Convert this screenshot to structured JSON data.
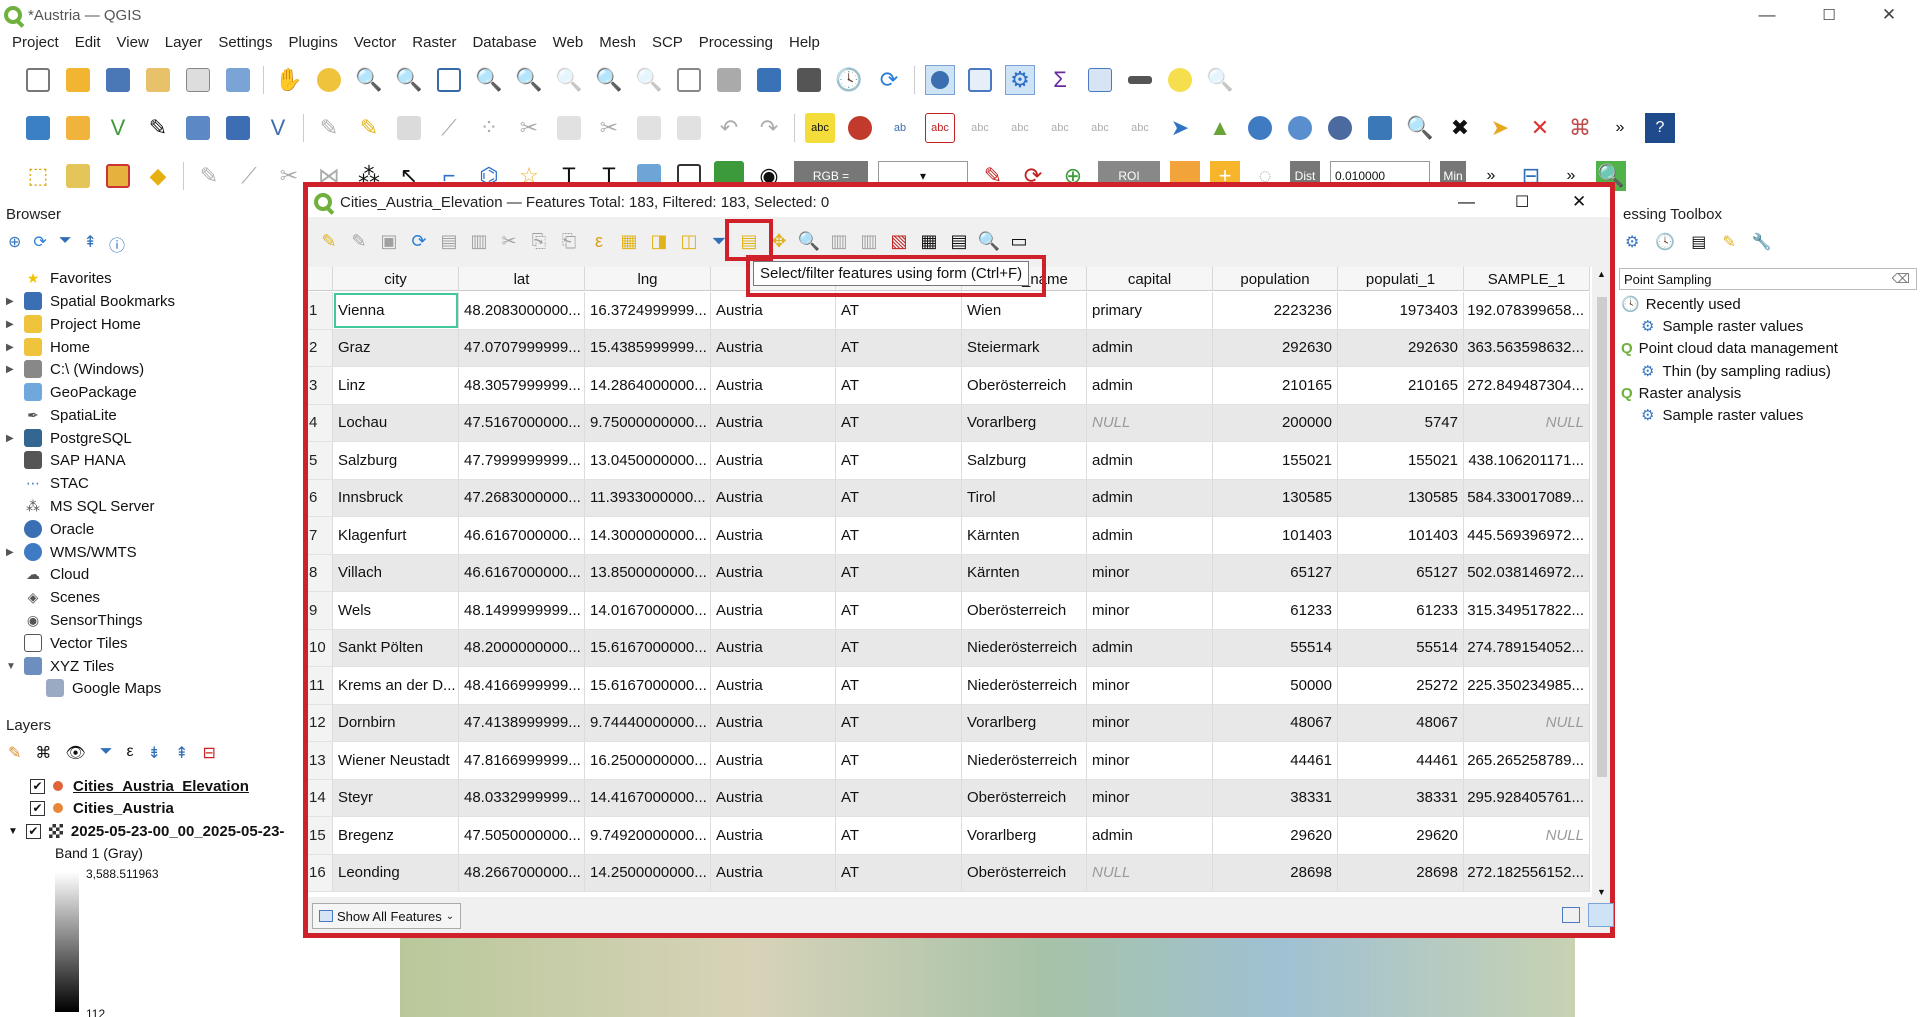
{
  "window": {
    "title": "*Austria — QGIS",
    "minimize": "—",
    "maximize": "☐",
    "close": "✕"
  },
  "menu": [
    "Project",
    "Edit",
    "View",
    "Layer",
    "Settings",
    "Plugins",
    "Vector",
    "Raster",
    "Database",
    "Web",
    "Mesh",
    "SCP",
    "Processing",
    "Help"
  ],
  "toolbar3": {
    "rgb_label": "RGB =",
    "roi_label": "ROI",
    "dist_label": "Dist",
    "dist_value": "0.010000",
    "min_label": "Min"
  },
  "browser": {
    "title": "Browser",
    "items": [
      "Favorites",
      "Spatial Bookmarks",
      "Project Home",
      "Home",
      "C:\\ (Windows)",
      "GeoPackage",
      "SpatiaLite",
      "PostgreSQL",
      "SAP HANA",
      "STAC",
      "MS SQL Server",
      "Oracle",
      "WMS/WMTS",
      "Cloud",
      "Scenes",
      "SensorThings",
      "Vector Tiles",
      "XYZ Tiles",
      "Google Maps"
    ]
  },
  "layers": {
    "title": "Layers",
    "items": [
      "Cities_Austria_Elevation",
      "Cities_Austria",
      "2025-05-23-00_00_2025-05-23-"
    ],
    "band": "Band 1 (Gray)",
    "max": "3,588.511963",
    "min": "112"
  },
  "toolbox": {
    "title": "essing Toolbox",
    "search": "Point Sampling",
    "items": [
      "Recently used",
      "Sample raster values",
      "Point cloud data management",
      "Thin (by sampling radius)",
      "Raster analysis",
      "Sample raster values"
    ]
  },
  "dialog": {
    "title": "Cities_Austria_Elevation — Features Total: 183, Filtered: 183, Selected: 0",
    "tooltip": "Select/filter features using form (Ctrl+F)",
    "show_all": "Show All Features"
  },
  "table": {
    "columns": [
      "city",
      "lat",
      "lng",
      "",
      "",
      "_name",
      "capital",
      "population",
      "populati_1",
      "SAMPLE_1"
    ],
    "rows": [
      [
        "1",
        "Vienna",
        "48.2083000000...",
        "16.3724999999...",
        "Austria",
        "AT",
        "Wien",
        "primary",
        "2223236",
        "1973403",
        "192.078399658..."
      ],
      [
        "2",
        "Graz",
        "47.0707999999...",
        "15.4385999999...",
        "Austria",
        "AT",
        "Steiermark",
        "admin",
        "292630",
        "292630",
        "363.563598632..."
      ],
      [
        "3",
        "Linz",
        "48.3057999999...",
        "14.2864000000...",
        "Austria",
        "AT",
        "Oberösterreich",
        "admin",
        "210165",
        "210165",
        "272.849487304..."
      ],
      [
        "4",
        "Lochau",
        "47.5167000000...",
        "9.75000000000...",
        "Austria",
        "AT",
        "Vorarlberg",
        "NULL",
        "200000",
        "5747",
        "NULL"
      ],
      [
        "5",
        "Salzburg",
        "47.7999999999...",
        "13.0450000000...",
        "Austria",
        "AT",
        "Salzburg",
        "admin",
        "155021",
        "155021",
        "438.106201171..."
      ],
      [
        "6",
        "Innsbruck",
        "47.2683000000...",
        "11.3933000000...",
        "Austria",
        "AT",
        "Tirol",
        "admin",
        "130585",
        "130585",
        "584.330017089..."
      ],
      [
        "7",
        "Klagenfurt",
        "46.6167000000...",
        "14.3000000000...",
        "Austria",
        "AT",
        "Kärnten",
        "admin",
        "101403",
        "101403",
        "445.569396972..."
      ],
      [
        "8",
        "Villach",
        "46.6167000000...",
        "13.8500000000...",
        "Austria",
        "AT",
        "Kärnten",
        "minor",
        "65127",
        "65127",
        "502.038146972..."
      ],
      [
        "9",
        "Wels",
        "48.1499999999...",
        "14.0167000000...",
        "Austria",
        "AT",
        "Oberösterreich",
        "minor",
        "61233",
        "61233",
        "315.349517822..."
      ],
      [
        "10",
        "Sankt Pölten",
        "48.2000000000...",
        "15.6167000000...",
        "Austria",
        "AT",
        "Niederösterreich",
        "admin",
        "55514",
        "55514",
        "274.789154052..."
      ],
      [
        "11",
        "Krems an der D...",
        "48.4166999999...",
        "15.6167000000...",
        "Austria",
        "AT",
        "Niederösterreich",
        "minor",
        "50000",
        "25272",
        "225.350234985..."
      ],
      [
        "12",
        "Dornbirn",
        "47.4138999999...",
        "9.74440000000...",
        "Austria",
        "AT",
        "Vorarlberg",
        "minor",
        "48067",
        "48067",
        "NULL"
      ],
      [
        "13",
        "Wiener Neustadt",
        "47.8166999999...",
        "16.2500000000...",
        "Austria",
        "AT",
        "Niederösterreich",
        "minor",
        "44461",
        "44461",
        "265.265258789..."
      ],
      [
        "14",
        "Steyr",
        "48.0332999999...",
        "14.4167000000...",
        "Austria",
        "AT",
        "Oberösterreich",
        "minor",
        "38331",
        "38331",
        "295.928405761..."
      ],
      [
        "15",
        "Bregenz",
        "47.5050000000...",
        "9.74920000000...",
        "Austria",
        "AT",
        "Vorarlberg",
        "admin",
        "29620",
        "29620",
        "NULL"
      ],
      [
        "16",
        "Leonding",
        "48.2667000000...",
        "14.2500000000...",
        "Austria",
        "AT",
        "Oberösterreich",
        "NULL",
        "28698",
        "28698",
        "272.182556152..."
      ]
    ]
  },
  "colors": {
    "highlight": "#d0202a",
    "qgis_green": "#6fb13c",
    "selection": "#42c99a"
  }
}
